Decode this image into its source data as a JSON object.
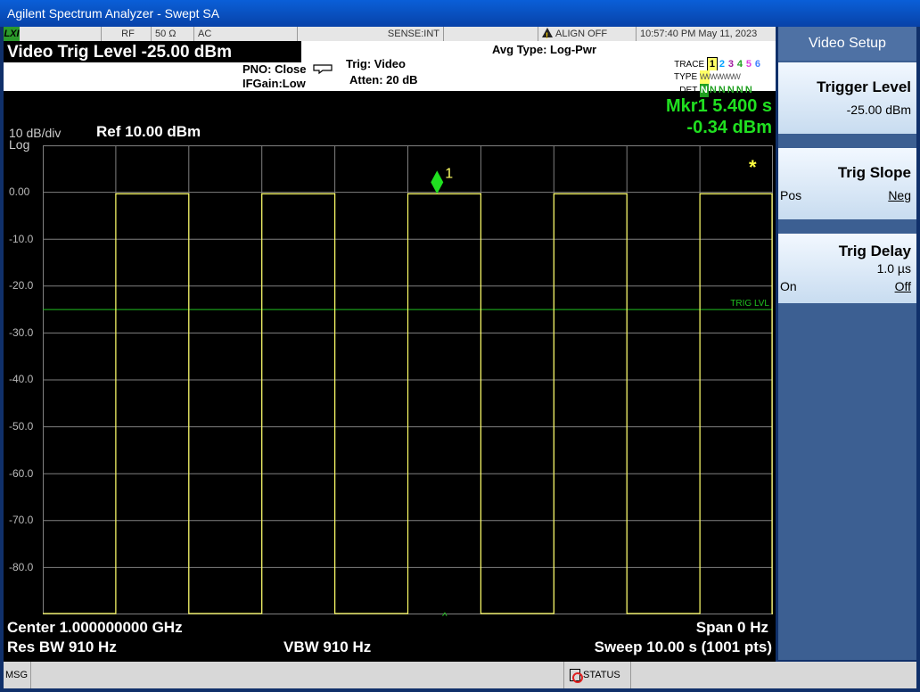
{
  "window": {
    "title": "Agilent Spectrum Analyzer - Swept SA"
  },
  "status_strip": {
    "lxi": "LXI",
    "rf": "RF",
    "impedance": "50 Ω",
    "coupling": "AC",
    "sense": "SENSE:INT",
    "align": "ALIGN OFF",
    "datetime": "10:57:40 PM May 11, 2023"
  },
  "header": {
    "active_function": "Video Trig Level -25.00 dBm",
    "pno": "PNO: Close",
    "ifgain": "IFGain:Low",
    "trig": "Trig: Video",
    "atten": "Atten: 20 dB",
    "avg_type": "Avg Type: Log-Pwr",
    "trace_label": "TRACE",
    "type_label": "TYPE",
    "det_label": "DET",
    "trace_nums": [
      "1",
      "2",
      "3",
      "4",
      "5",
      "6"
    ],
    "type_values": "WWWWWW",
    "det_values": [
      "N",
      "N",
      "N",
      "N",
      "N",
      "N"
    ]
  },
  "marker": {
    "line1": "Mkr1 5.400 s",
    "line2": "-0.34 dBm",
    "label": "1"
  },
  "display": {
    "scale": "10 dB/div",
    "log": "Log",
    "ref": "Ref 10.00 dBm",
    "trig_lvl_label": "TRIG LVL",
    "y_labels": [
      "0.00",
      "-10.0",
      "-20.0",
      "-30.0",
      "-40.0",
      "-50.0",
      "-60.0",
      "-70.0",
      "-80.0"
    ]
  },
  "footer": {
    "center": "Center 1.000000000 GHz",
    "span": "Span 0 Hz",
    "res_bw": "Res BW 910 Hz",
    "vbw": "VBW 910 Hz",
    "sweep": "Sweep  10.00 s (1001 pts)"
  },
  "msgbar": {
    "msg": "MSG",
    "status": "STATUS"
  },
  "softkeys": {
    "menu_title": "Video Setup",
    "trigger_level": {
      "label": "Trigger Level",
      "value": "-25.00 dBm"
    },
    "trig_slope": {
      "label": "Trig Slope",
      "left": "Pos",
      "right": "Neg"
    },
    "trig_delay": {
      "label": "Trig Delay",
      "value": "1.0 µs",
      "left": "On",
      "right": "Off"
    }
  },
  "chart_data": {
    "type": "line",
    "y_unit": "dBm",
    "ylim": [
      -90,
      10
    ],
    "xlim": [
      0,
      10
    ],
    "trigger_level_dbm": -25,
    "marker": {
      "x": 5.4,
      "y": -0.34
    },
    "pulses": [
      {
        "start": 1.0,
        "end": 2.0
      },
      {
        "start": 3.0,
        "end": 4.0
      },
      {
        "start": 5.0,
        "end": 6.0
      },
      {
        "start": 7.0,
        "end": 8.0
      },
      {
        "start": 9.0,
        "end": 10.0
      }
    ],
    "high_level": -0.34,
    "low_level": -90,
    "colors": {
      "trace": "#ffff66",
      "grid": "#808080",
      "trig": "#20c020",
      "marker": "#20e020"
    }
  }
}
